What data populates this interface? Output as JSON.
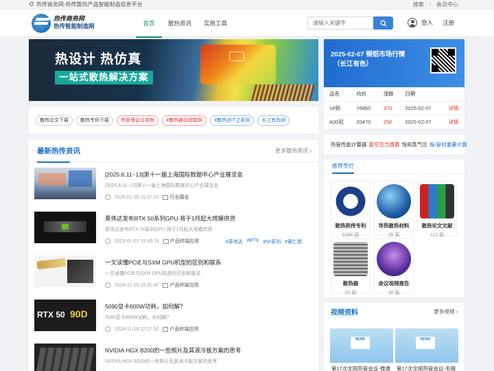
{
  "topbar": {
    "site": "热传商务网-热传散热产品智能制造信息平台",
    "search": "搜索",
    "member": "会员中心"
  },
  "header": {
    "logo_line1": "热传商务网",
    "logo_line2": "热传智能制造网",
    "nav": [
      "首页",
      "散热资讯",
      "实用工具"
    ],
    "search_placeholder": "请输入关键字",
    "login": "登入",
    "register": "注册"
  },
  "banner": {
    "line1": "热设计 热仿真",
    "line2": "一站式散热解决方案"
  },
  "tags": [
    {
      "label": "散热论文下载",
      "style": "plain"
    },
    {
      "label": "散热专利下载",
      "style": "plain"
    },
    {
      "label": "热管理会议视频",
      "style": "red"
    },
    {
      "label": "#散热器@超能网",
      "style": "red"
    },
    {
      "label": "#散热@IT之家网",
      "style": "blue"
    },
    {
      "label": "长江有色网",
      "style": "blue"
    }
  ],
  "news": {
    "title": "最新热传资讯",
    "more": "更多散热资讯",
    "items": [
      {
        "title": "[2025.6.11~13]第十一届上海国际数据中心产业展览会",
        "summary": "[2025.6.11~13]第十一届上海国际数据中心产业展览会",
        "date": "2025-01-20 11:27:10",
        "category": "行业展会",
        "tags": []
      },
      {
        "title": "英伟达发布RTX 50系列GPU 将于1月起大规模供货",
        "summary": "英伟达发布RTX 50系列GPU 将于1月起大规模供货",
        "date": "2025-01-07 15:45:15",
        "category": "产品终端应用",
        "tags": [
          "#英伟达",
          "#RTX",
          "#50系列",
          "#黄仁勋"
        ]
      },
      {
        "title": "一文读懂PCIE与SXM GPU机型的区别和联系",
        "summary": "一文读懂PCIE与SXM GPU机型的区别和联系",
        "date": "2024-11-19 22:31:47",
        "category": "产品终端应用",
        "tags": []
      },
      {
        "title": "5090显卡600W功耗，如何解？",
        "summary": "5090显卡600W功耗，如何解？",
        "date": "2024-11-19 22:27:51",
        "category": "产品终端应用",
        "tags": []
      },
      {
        "title": "NVIDIA HGX B200的一些照片及其液冷板方案的思考",
        "summary": "NVIDIA HGX B200的一些照片及其液冷板方案的思考",
        "date": "",
        "category": "",
        "tags": []
      }
    ]
  },
  "price": {
    "title_line1": "2025-02-07  铜铝市场行情",
    "title_line2": "（长江有色）",
    "headers": [
      "品名",
      "均价",
      "涨跌",
      "日期",
      ""
    ],
    "rows": [
      {
        "name": "1#铜",
        "avg": "76860",
        "change": "370",
        "date": "2025-02-07",
        "action": "详情"
      },
      {
        "name": "A00铝",
        "avg": "20470",
        "change": "250",
        "date": "2025-02-07",
        "action": "详情"
      }
    ]
  },
  "calc": {
    "a": "热管性能计算器",
    "b": "真空压力换算",
    "c": "饱和蒸气压",
    "d": "板/管材重量计算"
  },
  "recommend": {
    "title": "推荐专栏",
    "cards": [
      {
        "name": "散热热传专利",
        "count": "5384 篇"
      },
      {
        "name": "导热散热材料",
        "count": "35 篇"
      },
      {
        "name": "散热论文文献",
        "count": "112 篇"
      },
      {
        "name": "散热器",
        "count": "20 篇"
      },
      {
        "name": "会议视频报告",
        "count": "38 篇"
      }
    ]
  },
  "video": {
    "title": "视频资料",
    "more": "更多视频",
    "items": [
      "第17次全国热管会议-微通",
      "第17次全国热管会议-毛细"
    ]
  }
}
